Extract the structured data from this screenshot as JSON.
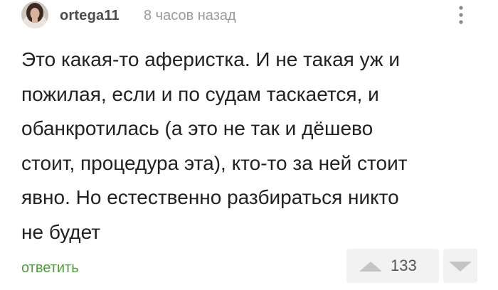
{
  "comment": {
    "author": "ortega11",
    "time": "8 часов назад",
    "text_lines": [
      "Это какая-то аферистка. И не такая уж и",
      "пожилая, если и по судам таскается, и",
      "обанкротилась (а это не так и дёшево",
      "стоит, процедура эта), кто-то за ней стоит",
      "явно. Но естественно разбираться никто",
      "не будет"
    ],
    "reply_label": "ответить",
    "rating": "133"
  },
  "icons": {
    "avatar": "user-avatar",
    "menu": "more-vertical-icon",
    "upvote": "triangle-up-icon",
    "downvote": "triangle-down-icon"
  },
  "colors": {
    "reply": "#4e9c3a",
    "vote_bg": "#f2f2f2",
    "vote_icon": "#c4c4c4"
  }
}
